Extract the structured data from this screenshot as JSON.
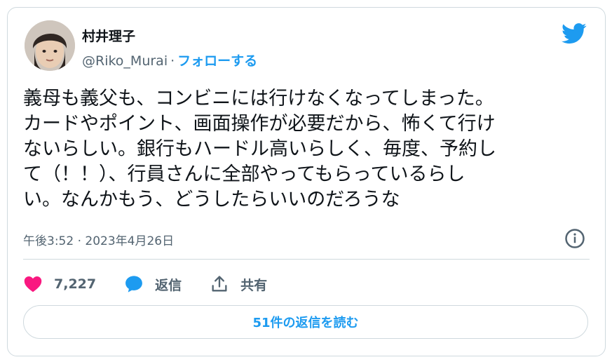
{
  "author": {
    "display_name": "村井理子",
    "handle": "@Riko_Murai",
    "separator": "·",
    "follow_label": "フォローする"
  },
  "tweet": {
    "text": "義母も義父も、コンビニには行けなくなってしまった。\nカードやポイント、画面操作が必要だから、怖くて行け\nないらしい。銀行もハードル高いらしく、毎度、予約し\nて（！！）、行員さんに全部やってもらっているらし\nい。なんかもう、どうしたらいいのだろうな",
    "timestamp": "午後3:52 · 2023年4月26日"
  },
  "actions": {
    "like_count": "7,227",
    "reply_label": "返信",
    "share_label": "共有"
  },
  "read_replies_label": "51件の返信を読む",
  "colors": {
    "accent": "#1d9bf0",
    "like": "#f91880",
    "muted": "#536471",
    "border": "#cfd9de"
  },
  "icons": [
    "twitter-bird-icon",
    "info-icon",
    "heart-icon",
    "speech-bubble-icon",
    "share-upload-icon"
  ]
}
